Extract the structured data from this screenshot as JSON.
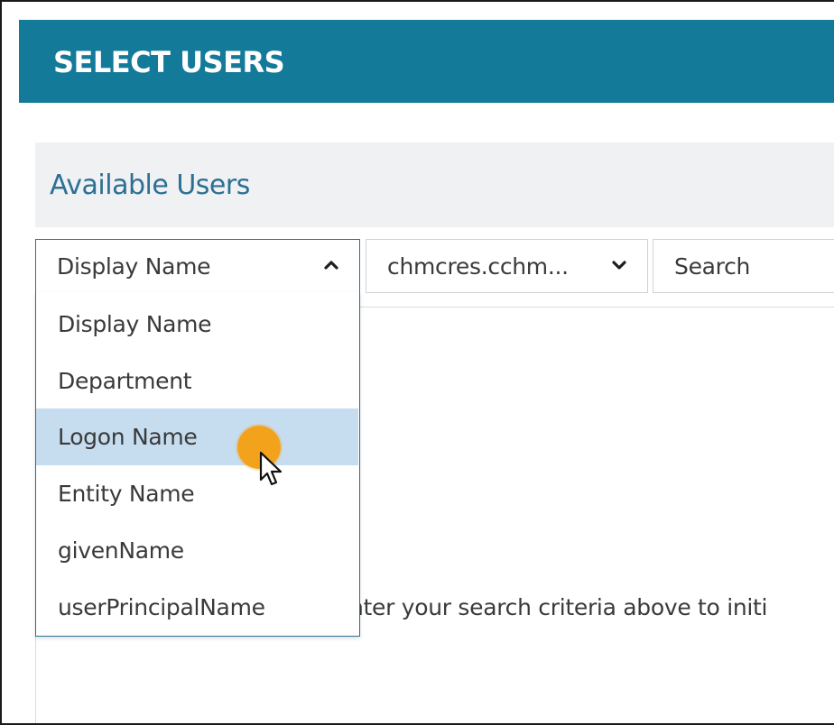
{
  "header": {
    "title": "SELECT USERS",
    "bg_color": "#137a99"
  },
  "section": {
    "title": "Available Users"
  },
  "filter": {
    "selected": "Display Name",
    "chevron_icon": "chevron-up-icon",
    "options": [
      {
        "label": "Display Name",
        "highlighted": false
      },
      {
        "label": "Department",
        "highlighted": false
      },
      {
        "label": "Logon Name",
        "highlighted": true
      },
      {
        "label": "Entity Name",
        "highlighted": false
      },
      {
        "label": "givenName",
        "highlighted": false
      },
      {
        "label": "userPrincipalName",
        "highlighted": false
      }
    ],
    "highlight_color": "#c6dcef"
  },
  "domain": {
    "selected": "chmcres.cchm...",
    "chevron_icon": "chevron-down-icon"
  },
  "search": {
    "placeholder": "Search"
  },
  "content": {
    "hint": "nter your search criteria above to initi"
  },
  "cursor": {
    "icon": "mouse-pointer-icon",
    "highlight_color": "#f2a31b"
  }
}
